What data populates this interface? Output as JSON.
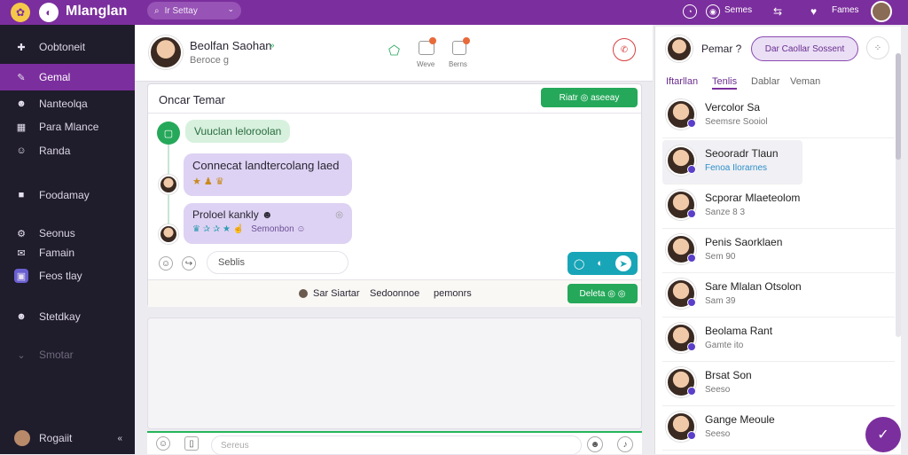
{
  "topbar": {
    "title": "Mlanglan",
    "search_text": "Ir Settay",
    "right_item_1": "Semes",
    "right_item_2": "Fames"
  },
  "sidebar": {
    "items": [
      {
        "label": "Oobtoneit",
        "icon": "puzzle-icon"
      },
      {
        "label": "Gemal",
        "icon": "chat-icon",
        "active": true
      },
      {
        "label": "Nanteolqa",
        "icon": "people-icon"
      },
      {
        "label": "Para Mlance",
        "icon": "table-icon"
      },
      {
        "label": "Randa",
        "icon": "user-icon"
      },
      {
        "label": "Foodamay",
        "icon": "box-icon"
      },
      {
        "label": "Seonus",
        "icon": "gear-icon"
      },
      {
        "label": "Famain",
        "icon": "mail-icon"
      },
      {
        "label": "Feos tlay",
        "icon": "app-icon"
      },
      {
        "label": "Stetdkay",
        "icon": "user-circle-icon"
      },
      {
        "label": "Smotar",
        "icon": "down-icon"
      }
    ],
    "footer_label": "Rogaiit"
  },
  "chat_header": {
    "name": "Beolfan Saohan",
    "status": "Beroce g",
    "badge_1": "Weve",
    "badge_2": "Berns"
  },
  "thread": {
    "title": "Oncar Temar",
    "header_button": "Riatr ◎ aseeay",
    "messages": [
      {
        "text": "Vuuclan leloroolan",
        "style": "green"
      },
      {
        "text": "Connecat landtercolang laed",
        "reactions": "★ ♟ ♛"
      },
      {
        "text": "Proloel kankly ☻",
        "reactions": "♛ ✰ ✰ ★ ☝",
        "extra": "Semonbon ☺"
      }
    ],
    "input_placeholder": "Seblis"
  },
  "bar": {
    "item_1": "Sar Siartar",
    "item_2": "Sedoonnoe",
    "item_3": "pemonrs",
    "button": "Deleta ◎ ◎"
  },
  "composer": {
    "placeholder": "Sereus"
  },
  "right_panel": {
    "header_name": "Pemar ?",
    "header_button": "Dar Caollar Sossent",
    "tabs": [
      "Iftarllan",
      "Tenlis",
      "Dablar",
      "Veman"
    ],
    "contacts": [
      {
        "name": "Vercolor Sa",
        "sub": "Seemsre Sooiol"
      },
      {
        "name": "Seooradr Tlaun",
        "sub": "Fenoa Ilorarnes"
      },
      {
        "name": "Scporar Mlaeteolom",
        "sub": "Sanze 8 3"
      },
      {
        "name": "Penis Saorklaen",
        "sub": "Sem 90"
      },
      {
        "name": "Sare Mlalan Otsolon",
        "sub": "Sam 39"
      },
      {
        "name": "Beolama Rant",
        "sub": "Gamte ito"
      },
      {
        "name": "Brsat Son",
        "sub": "Seeso"
      },
      {
        "name": "Gange Meoule",
        "sub": "Seeso"
      }
    ]
  },
  "colors": {
    "accent": "#7b2e9d",
    "green": "#25a85a",
    "sidebar": "#1f1c2c"
  }
}
